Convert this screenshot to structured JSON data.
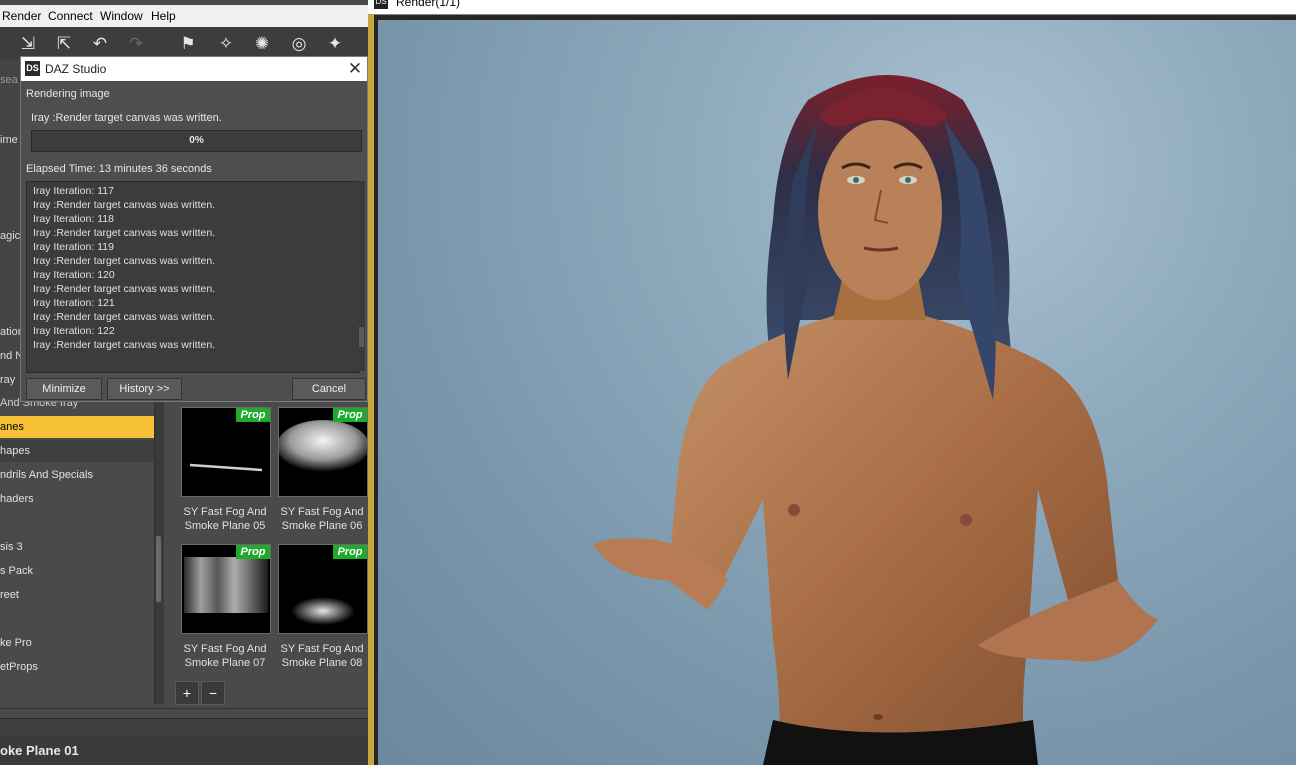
{
  "menubar": {
    "items": [
      "Render",
      "Connect",
      "Window",
      "Help"
    ]
  },
  "side_strip": {
    "labels": [
      "sea",
      "ime",
      "agic",
      "ation",
      "nd N",
      "ray"
    ]
  },
  "categories": [
    "And Smoke Iray",
    "anes",
    "hapes",
    "ndrils And Specials",
    "haders",
    "sis 3",
    "s Pack",
    "reet",
    "ke Pro",
    "etProps"
  ],
  "selected_category_index": 1,
  "thumbnails": {
    "badge": "Prop",
    "items": [
      {
        "caption_line1": "SY Fast Fog And",
        "caption_line2": "Smoke Plane 05"
      },
      {
        "caption_line1": "SY Fast Fog And",
        "caption_line2": "Smoke Plane 06"
      },
      {
        "caption_line1": "SY Fast Fog And",
        "caption_line2": "Smoke Plane 07"
      },
      {
        "caption_line1": "SY Fast Fog And",
        "caption_line2": "Smoke Plane 08"
      }
    ]
  },
  "buttons": {
    "plus": "+",
    "minus": "−"
  },
  "bottom_title": "oke Plane 01",
  "dialog": {
    "icon": "DS",
    "title": "DAZ Studio",
    "status_heading": "Rendering image",
    "status_message": "Iray :Render target canvas was written.",
    "progress_text": "0%",
    "progress_fraction": 0.0,
    "elapsed": "Elapsed Time:  13 minutes 36 seconds",
    "log": [
      "Iray Iteration: 117",
      "Iray :Render target canvas was written.",
      "Iray Iteration: 118",
      "Iray :Render target canvas was written.",
      "Iray Iteration: 119",
      "Iray :Render target canvas was written.",
      "Iray Iteration: 120",
      "Iray :Render target canvas was written.",
      "Iray Iteration: 121",
      "Iray :Render target canvas was written.",
      "Iray Iteration: 122",
      "Iray :Render target canvas was written."
    ],
    "btn_minimize": "Minimize",
    "btn_history": "History >>",
    "btn_cancel": "Cancel"
  },
  "render_window": {
    "icon": "DS",
    "title": "Render(1/1)"
  }
}
